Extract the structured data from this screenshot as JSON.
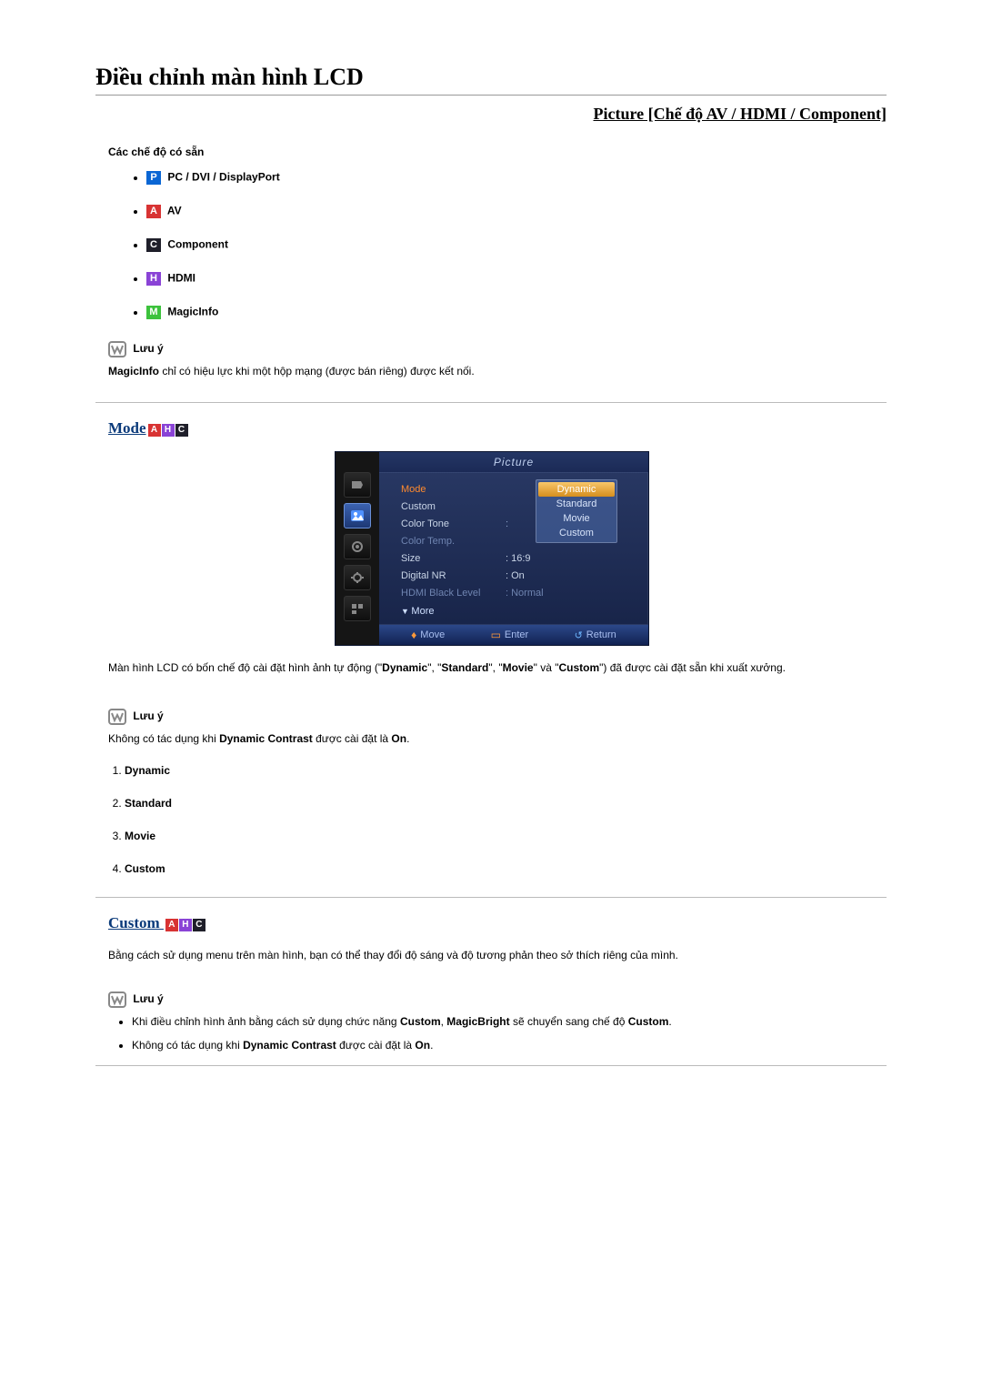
{
  "page_title": "Điều chỉnh màn hình LCD",
  "picture_subtitle": "Picture [Chế độ AV / HDMI / Component]",
  "modes_header": "Các chế độ có sẵn",
  "mode_icons": {
    "P": {
      "letter": "P",
      "label": "PC / DVI / DisplayPort"
    },
    "A": {
      "letter": "A",
      "label": "AV"
    },
    "C": {
      "letter": "C",
      "label": "Component"
    },
    "H": {
      "letter": "H",
      "label": "HDMI"
    },
    "M": {
      "letter": "M",
      "label": "MagicInfo"
    }
  },
  "note_label": "Lưu ý",
  "note1_pre": "MagicInfo",
  "note1_rest": " chỉ có hiệu lực khi một hộp mạng (được bán riêng) được kết nối.",
  "mode_section_title": "Mode",
  "osd": {
    "title": "Picture",
    "rows": {
      "mode": {
        "label": "Mode",
        "value": "Dynamic",
        "active": true
      },
      "custom": {
        "label": "Custom",
        "value": ""
      },
      "colortone": {
        "label": "Color Tone",
        "value": ":"
      },
      "colortemp": {
        "label": "Color Temp.",
        "value": "",
        "dim": true
      },
      "size": {
        "label": "Size",
        "value": ": 16:9"
      },
      "digitalnr": {
        "label": "Digital NR",
        "value": ": On"
      },
      "hdmiblack": {
        "label": "HDMI Black Level",
        "value": ": Normal",
        "dim": true
      }
    },
    "more": "More",
    "popup": [
      "Dynamic",
      "Standard",
      "Movie",
      "Custom"
    ],
    "footer": {
      "move": "Move",
      "enter": "Enter",
      "return": "Return"
    }
  },
  "mode_body_pre": "Màn hình LCD có bốn chế độ cài đặt hình ảnh tự động (\"",
  "mode_b1": "Dynamic",
  "mode_mid1": "\", \"",
  "mode_b2": "Standard",
  "mode_mid2": "\", \"",
  "mode_b3": "Movie",
  "mode_mid3": "\" và \"",
  "mode_b4": "Custom",
  "mode_post": "\") đã được cài đặt sẵn khi xuất xưởng.",
  "note2_pre": "Không có tác dụng khi ",
  "note2_b": "Dynamic Contrast",
  "note2_mid": " được cài đặt là ",
  "note2_b2": "On",
  "note2_post": ".",
  "mode_options": [
    "Dynamic",
    "Standard",
    "Movie",
    "Custom"
  ],
  "custom_section_title": "Custom ",
  "custom_body": "Bằng cách sử dụng menu trên màn hình, bạn có thể thay đổi độ sáng và độ tương phản theo sở thích riêng của mình.",
  "custom_note1_pre": "Khi điều chỉnh hình ảnh bằng cách sử dụng chức năng ",
  "custom_note1_b1": "Custom",
  "custom_note1_mid": ", ",
  "custom_note1_b2": "MagicBright",
  "custom_note1_mid2": " sẽ chuyển sang chế độ ",
  "custom_note1_b3": "Custom",
  "custom_note1_post": "."
}
